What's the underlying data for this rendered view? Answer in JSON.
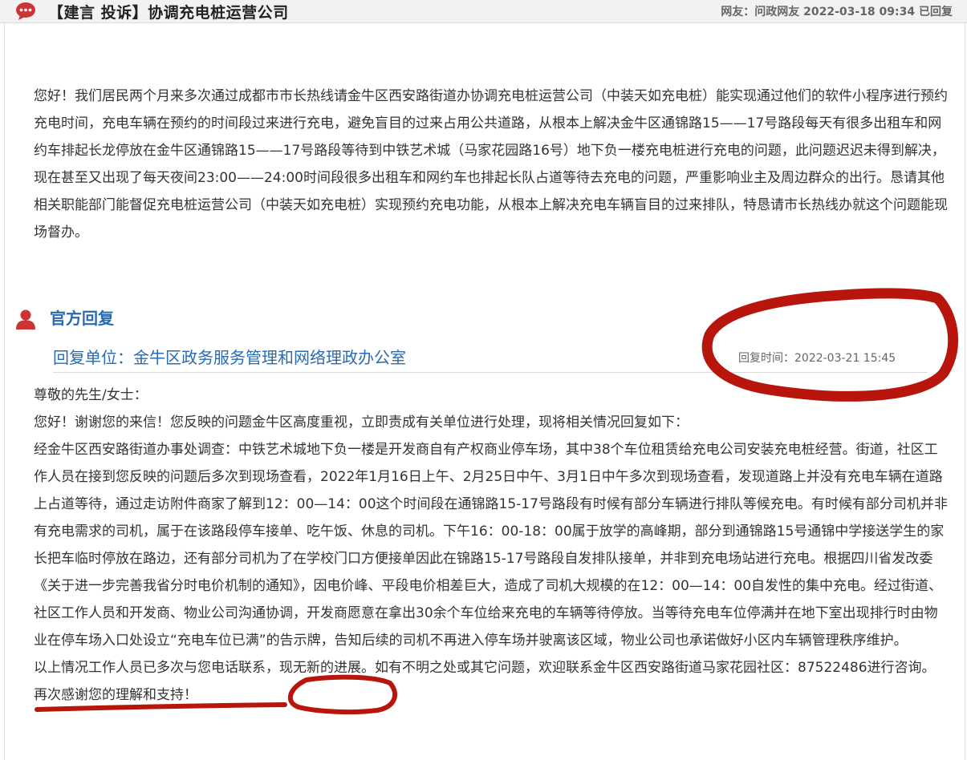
{
  "post": {
    "title": "【建言 投诉】协调充电桩运营公司",
    "meta": "网友：问政网友  2022-03-18 09:34 已回复",
    "content": "您好！我们居民两个月来多次通过成都市市长热线请金牛区西安路街道办协调充电桩运营公司（中装天如充电桩）能实现通过他们的软件小程序进行预约充电时间，充电车辆在预约的时间段过来进行充电，避免盲目的过来占用公共道路，从根本上解决金牛区通锦路15——17号路段每天有很多出租车和网约车排起长龙停放在金牛区通锦路15——17号路段等待到中铁艺术城（马家花园路16号）地下负一楼充电桩进行充电的问题，此问题迟迟未得到解决，现在甚至又出现了每天夜间23:00——24:00时间段很多出租车和网约车也排起长队占道等待去充电的问题，严重影响业主及周边群众的出行。恳请其他相关职能部门能督促充电桩运营公司（中装天如充电桩）实现预约充电功能，从根本上解决充电车辆盲目的过来排队，特恳请市长热线办就这个问题能现场督办。"
  },
  "reply": {
    "section_title": "官方回复",
    "unit": "回复单位：金牛区政务服务管理和网络理政办公室",
    "time": "回复时间：2022-03-21 15:45",
    "paragraphs": [
      "尊敬的先生/女士：",
      "您好！谢谢您的来信！您反映的问题金牛区高度重视，立即责成有关单位进行处理，现将相关情况回复如下：",
      "经金牛区西安路街道办事处调查：中铁艺术城地下负一楼是开发商自有产权商业停车场，其中38个车位租赁给充电公司安装充电桩经营。街道，社区工作人员在接到您反映的问题后多次到现场查看，2022年1月16日上午、2月25日中午、3月1日中午多次到现场查看，发现道路上并没有充电车辆在道路上占道等待，通过走访附件商家了解到12：00—14：00这个时间段在通锦路15-17号路段有时候有部分车辆进行排队等候充电。有时候有部分司机并非有充电需求的司机，属于在该路段停车接单、吃午饭、休息的司机。下午16：00-18：00属于放学的高峰期，部分到通锦路15号通锦中学接送学生的家长把车临时停放在路边，还有部分司机为了在学校门口方便接单因此在锦路15-17号路段自发排队接单，并非到充电场站进行充电。根据四川省发改委《关于进一步完善我省分时电价机制的通知》，因电价峰、平段电价相差巨大，造成了司机大规模的在12：00—14：00自发性的集中充电。经过街道、社区工作人员和开发商、物业公司沟通协调，开发商愿意在拿出30余个车位给来充电的车辆等待停放。当等待充电车位停满并在地下室出现排行时由物业在停车场入口处设立“充电车位已满”的告示牌，告知后续的司机不再进入停车场并驶离该区域，物业公司也承诺做好小区内车辆管理秩序维护。",
      "以上情况工作人员已多次与您电话联系，现无新的进展。如有不明之处或其它问题，欢迎联系金牛区西安路街道马家花园社区：87522486进行咨询。",
      "再次感谢您的理解和支持！"
    ]
  },
  "icons": {
    "title_icon": "chat-bubble-icon",
    "reply_icon": "person-icon"
  },
  "colors": {
    "accent_red": "#cc3333",
    "link_blue": "#2a6ab1",
    "annotation_red": "#b8160c",
    "text": "#333333"
  }
}
